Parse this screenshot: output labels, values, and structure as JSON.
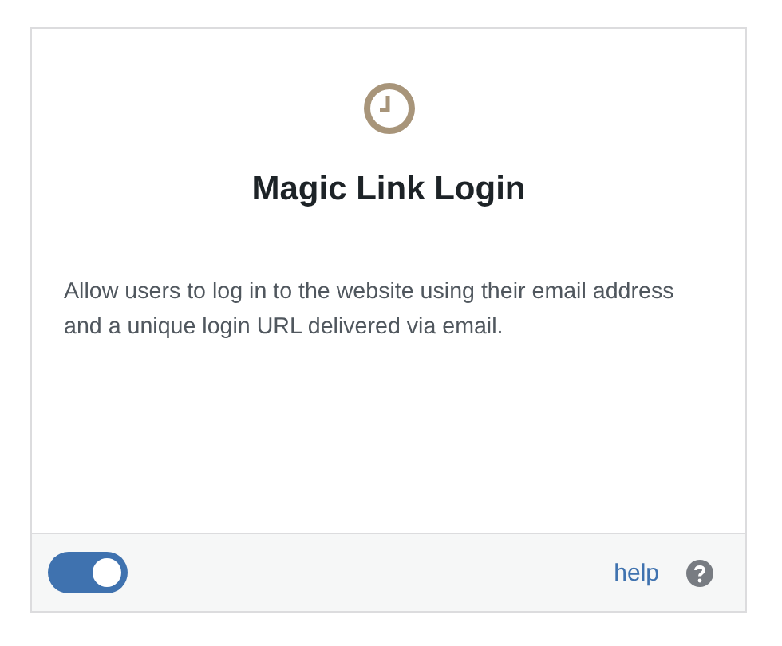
{
  "card": {
    "title": "Magic Link Login",
    "description": "Allow users to log in to the website using their email address and a unique login URL delivered via email."
  },
  "footer": {
    "toggle": {
      "on": true
    },
    "help_link": "help"
  }
}
